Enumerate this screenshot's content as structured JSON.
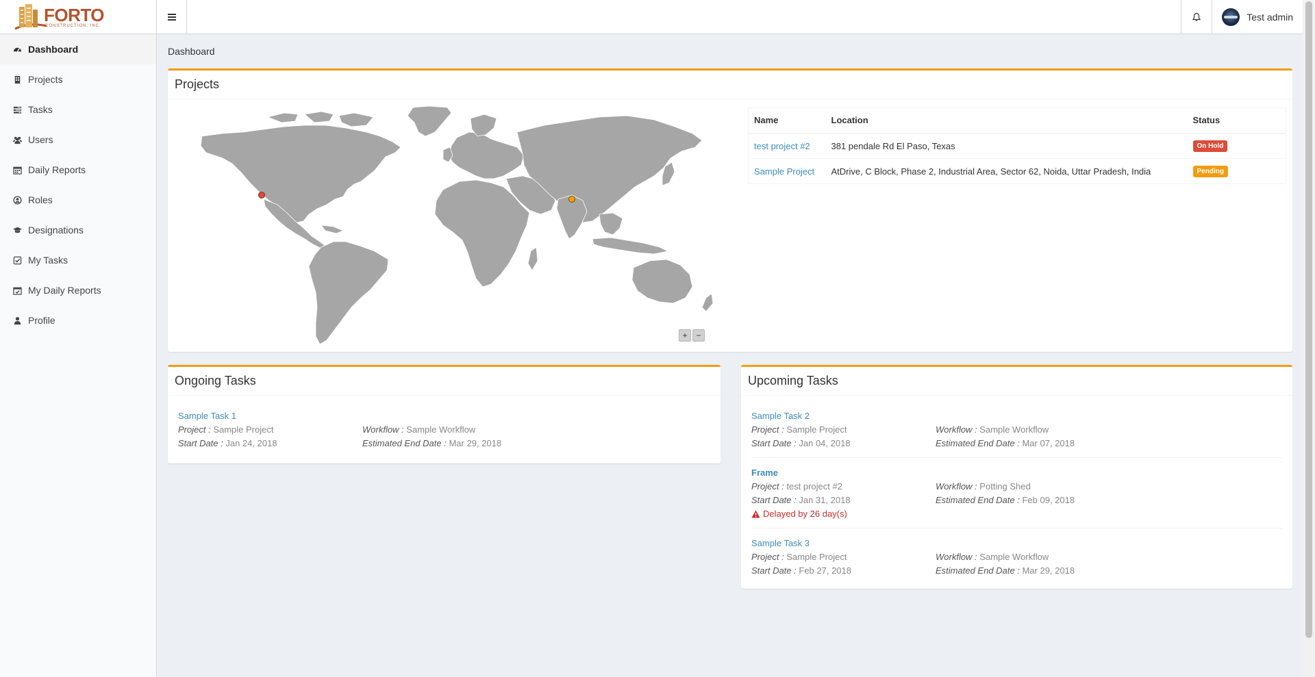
{
  "brand": {
    "name": "FORTO",
    "tagline": "CONSTRUCTION, INC."
  },
  "header": {
    "user_name": "Test admin"
  },
  "sidebar": {
    "items": [
      {
        "label": "Dashboard",
        "icon": "dashboard-icon",
        "active": true
      },
      {
        "label": "Projects",
        "icon": "building-icon"
      },
      {
        "label": "Tasks",
        "icon": "tasks-icon"
      },
      {
        "label": "Users",
        "icon": "users-icon"
      },
      {
        "label": "Daily Reports",
        "icon": "calendar-icon"
      },
      {
        "label": "Roles",
        "icon": "user-circle-icon"
      },
      {
        "label": "Designations",
        "icon": "graduation-cap-icon"
      },
      {
        "label": "My Tasks",
        "icon": "check-square-icon"
      },
      {
        "label": "My Daily Reports",
        "icon": "calendar-check-icon"
      },
      {
        "label": "Profile",
        "icon": "user-icon"
      }
    ]
  },
  "breadcrumb": "Dashboard",
  "projects": {
    "title": "Projects",
    "columns": [
      "Name",
      "Location",
      "Status"
    ],
    "rows": [
      {
        "name": "test project #2",
        "location": "381 pendale Rd El Paso, Texas",
        "status": "On Hold"
      },
      {
        "name": "Sample Project",
        "location": "AtDrive, C Block, Phase 2, Industrial Area, Sector 62, Noida, Uttar Pradesh, India",
        "status": "Pending"
      }
    ],
    "map": {
      "zoom_in": "+",
      "zoom_out": "−",
      "marker_colors": {
        "on_hold": "#dd4b39",
        "pending": "#f39c12"
      }
    }
  },
  "ongoing": {
    "title": "Ongoing Tasks",
    "tasks": [
      {
        "title": "Sample Task 1",
        "project_label": "Project :",
        "project": "Sample Project",
        "workflow_label": "Workflow :",
        "workflow": "Sample Workflow",
        "start_label": "Start Date :",
        "start": "Jan 24, 2018",
        "end_label": "Estimated End Date :",
        "end": "Mar 29, 2018"
      }
    ]
  },
  "upcoming": {
    "title": "Upcoming Tasks",
    "tasks": [
      {
        "title": "Sample Task 2",
        "project_label": "Project :",
        "project": "Sample Project",
        "workflow_label": "Workflow :",
        "workflow": "Sample Workflow",
        "start_label": "Start Date :",
        "start": "Jan 04, 2018",
        "end_label": "Estimated End Date :",
        "end": "Mar 07, 2018"
      },
      {
        "title": "Frame",
        "project_label": "Project :",
        "project": "test project #2",
        "workflow_label": "Workflow :",
        "workflow": "Potting Shed",
        "start_label": "Start Date :",
        "start": "Jan 31, 2018",
        "end_label": "Estimated End Date :",
        "end": "Feb 09, 2018",
        "delay": "Delayed by 26 day(s)"
      },
      {
        "title": "Sample Task 3",
        "project_label": "Project :",
        "project": "Sample Project",
        "workflow_label": "Workflow :",
        "workflow": "Sample Workflow",
        "start_label": "Start Date :",
        "start": "Feb 27, 2018",
        "end_label": "Estimated End Date :",
        "end": "Mar 29, 2018"
      }
    ]
  },
  "colors": {
    "accent": "#f39c12",
    "link": "#3c8dbc",
    "danger": "#dd4b39",
    "map_land": "#a6a6a6"
  }
}
